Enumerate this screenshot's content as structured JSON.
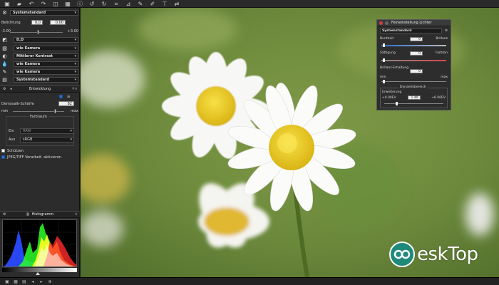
{
  "toolbar": {
    "icons": [
      "image-icon",
      "folder-open-icon",
      "undo-icon",
      "redo-icon",
      "compare-icon",
      "grid-icon",
      "info-icon",
      "rotate-left-icon",
      "rotate-right-icon",
      "crop-icon",
      "straighten-icon",
      "color-picker-icon",
      "brush-icon",
      "pin-icon",
      "transfer-icon"
    ]
  },
  "left_panel": {
    "preset": "Systemstandard",
    "exposure": {
      "label": "Belichtung",
      "value": "0,0",
      "value2": "0,00",
      "min": "-3.00",
      "max": "+3.00"
    },
    "dropdowns": [
      {
        "icon": "wb-icon",
        "value": "D,D"
      },
      {
        "icon": "picture-control-icon",
        "value": "wie Kamera"
      },
      {
        "icon": "contrast-icon",
        "value": "Mittlerer Kontrast"
      },
      {
        "icon": "droplet-icon",
        "value": "wie Kamera"
      },
      {
        "icon": "pen-icon",
        "value": "wie Kamera"
      },
      {
        "icon": "color-icon",
        "value": "Systemstandard"
      }
    ],
    "develop": {
      "header": "Entwicklung",
      "demosaic_label": "Demosaik-Schärfe",
      "demosaic_value": "82",
      "min": "min",
      "max": "max",
      "farbraum_label": "Farbraum",
      "ein_label": "Ein",
      "ein_value": "RAW",
      "aus_label": "Aus",
      "aus_value": "sRGB",
      "check1_label": "Schützen",
      "check2_label": "JPEG/TIFF Verarbeit. aktivieren"
    },
    "histogram": {
      "header": "Histogramm"
    }
  },
  "floating_panel": {
    "title": "Feineinstellung Lichter",
    "preset": "Systemstandard",
    "buntheit": {
      "label": "Buntheit",
      "value": "0",
      "right": "Brillanz"
    },
    "saettigung": {
      "label": "Sättigung",
      "value": "0",
      "right": "Farbton"
    },
    "brillanz_erhaltung": {
      "label": "Brillanz-Erhaltung",
      "value": "0",
      "min": "min",
      "max": "max"
    },
    "dynamik": {
      "header": "Dynamikbereich",
      "erweiterung_label": "Erweiterung",
      "value": "1.40",
      "min": "+0.00EV",
      "max": "+6.00EV"
    }
  },
  "status_bar": {
    "text": ""
  },
  "watermark": {
    "text": "eskTop"
  },
  "colors": {
    "accent": "#2a6fd6",
    "panel_bg": "#2c2c2c",
    "histogram_red": "#ff2a2a",
    "histogram_green": "#2aff2a",
    "histogram_blue": "#2a4bff",
    "histogram_yellow": "#ffff20"
  }
}
